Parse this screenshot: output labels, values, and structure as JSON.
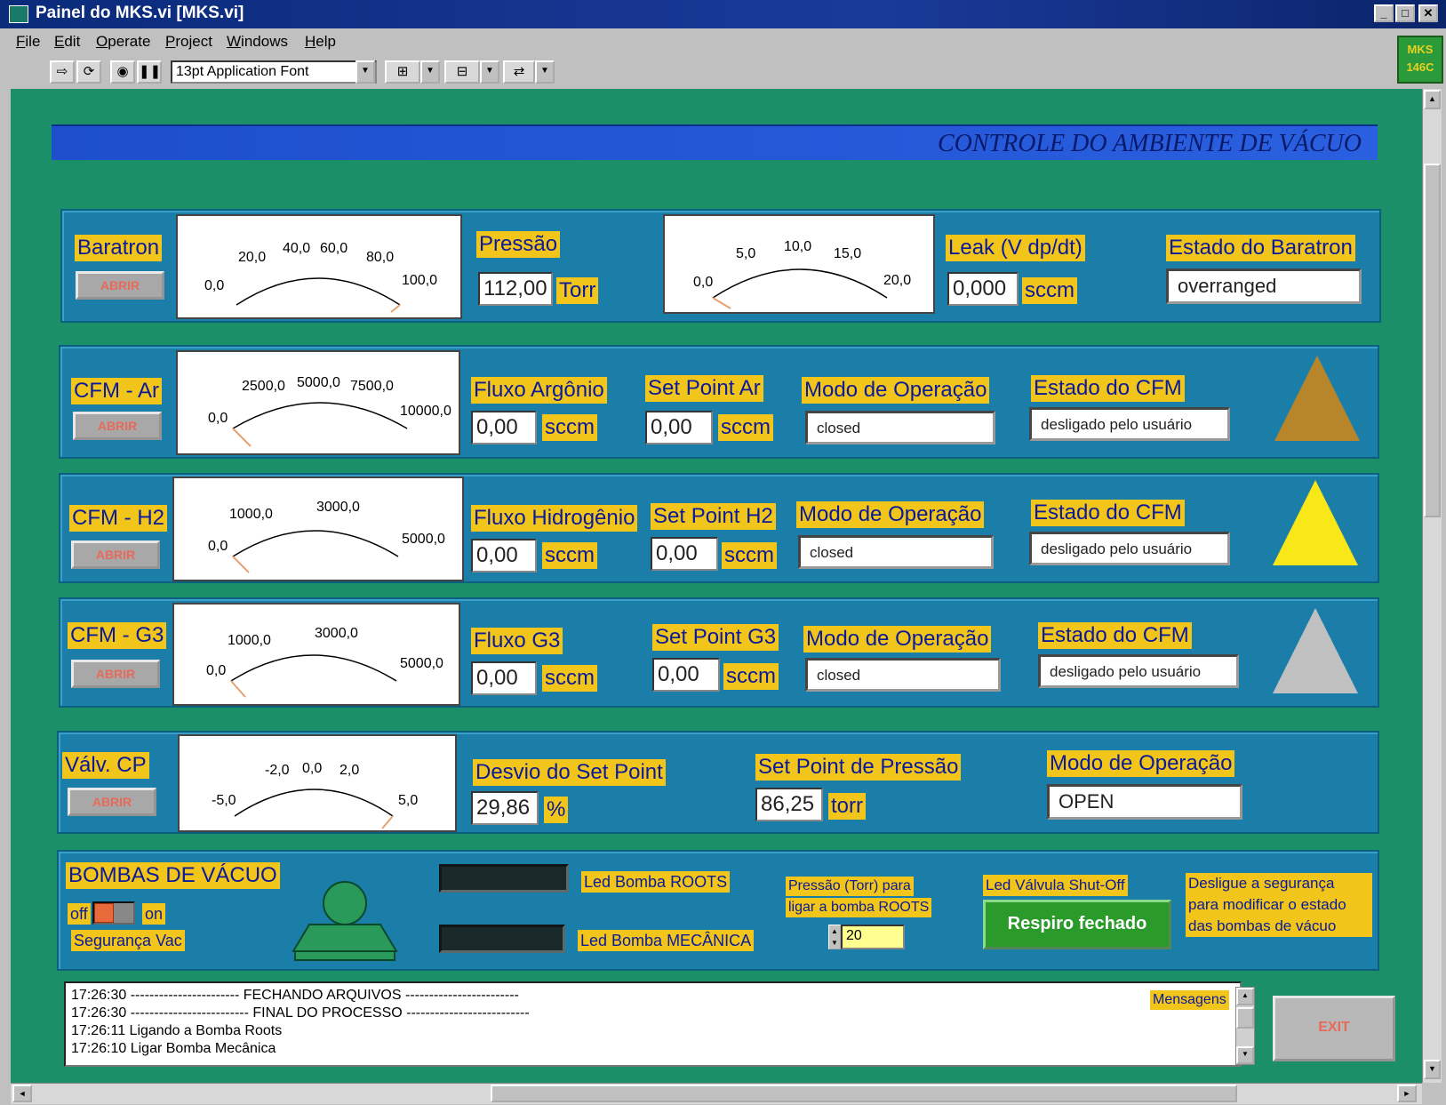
{
  "window": {
    "title": "Painel do MKS.vi [MKS.vi]",
    "buttons": [
      "_",
      "□",
      "✕"
    ]
  },
  "menu": [
    {
      "first": "F",
      "rest": "ile"
    },
    {
      "first": "E",
      "rest": "dit"
    },
    {
      "first": "O",
      "rest": "perate"
    },
    {
      "first": "P",
      "rest": "roject"
    },
    {
      "first": "W",
      "rest": "indows"
    },
    {
      "first": "H",
      "rest": "elp"
    }
  ],
  "toolbar": {
    "font": "13pt Application Font"
  },
  "badge": {
    "line1": "MKS",
    "line2": "146C"
  },
  "header": "CONTROLE DO AMBIENTE DE VÁCUO",
  "baratron": {
    "label": "Baratron",
    "button": "ABRIR",
    "gauge1": {
      "ticks": [
        "0,0",
        "20,0",
        "40,0",
        "60,0",
        "80,0",
        "100,0"
      ]
    },
    "pressao_label": "Pressão",
    "pressao_value": "112,00",
    "pressao_unit": "Torr",
    "gauge2": {
      "ticks": [
        "0,0",
        "5,0",
        "10,0",
        "15,0",
        "20,0"
      ]
    },
    "leak_label": "Leak (V dp/dt)",
    "leak_value": "0,000",
    "leak_unit": "sccm",
    "estado_label": "Estado do Baratron",
    "estado_value": "overranged"
  },
  "cfm_ar": {
    "label": "CFM - Ar",
    "button": "ABRIR",
    "ticks": [
      "0,0",
      "2500,0",
      "5000,0",
      "7500,0",
      "10000,0"
    ],
    "fluxo_label": "Fluxo Argônio",
    "fluxo_value": "0,00",
    "unit": "sccm",
    "sp_label": "Set Point Ar",
    "sp_value": "0,00",
    "modo_label": "Modo de Operação",
    "modo_value": "closed",
    "estado_label": "Estado do CFM",
    "estado_value": "desligado pelo usuário",
    "tri_color": "#b8862a"
  },
  "cfm_h2": {
    "label": "CFM - H2",
    "button": "ABRIR",
    "ticks": [
      "0,0",
      "1000,0",
      "3000,0",
      "5000,0"
    ],
    "fluxo_label": "Fluxo Hidrogênio",
    "fluxo_value": "0,00",
    "unit": "sccm",
    "sp_label": "Set Point H2",
    "sp_value": "0,00",
    "modo_label": "Modo de Operação",
    "modo_value": "closed",
    "estado_label": "Estado do CFM",
    "estado_value": "desligado pelo usuário",
    "tri_color": "#f8e81a"
  },
  "cfm_g3": {
    "label": "CFM - G3",
    "button": "ABRIR",
    "ticks": [
      "0,0",
      "1000,0",
      "3000,0",
      "5000,0"
    ],
    "fluxo_label": "Fluxo G3",
    "fluxo_value": "0,00",
    "unit": "sccm",
    "sp_label": "Set Point G3",
    "sp_value": "0,00",
    "modo_label": "Modo de Operação",
    "modo_value": "closed",
    "estado_label": "Estado do CFM",
    "estado_value": "desligado pelo usuário",
    "tri_color": "#c0c0c0"
  },
  "valv": {
    "label": "Válv. CP",
    "button": "ABRIR",
    "ticks": [
      "-5,0",
      "-2,0",
      "0,0",
      "2,0",
      "5,0"
    ],
    "desvio_label": "Desvio do Set Point",
    "desvio_value": "29,86",
    "desvio_unit": "%",
    "sp_label": "Set Point de Pressão",
    "sp_value": "86,25",
    "sp_unit": "torr",
    "modo_label": "Modo de Operação",
    "modo_value": "OPEN"
  },
  "bombas": {
    "label": "BOMBAS DE VÁCUO",
    "off": "off",
    "on": "on",
    "seguranca": "Segurança Vac",
    "led_roots": "Led Bomba ROOTS",
    "led_mecanica": "Led Bomba MECÂNICA",
    "pressao_label_1": "Pressão (Torr)  para",
    "pressao_label_2": "ligar a bomba  ROOTS",
    "pressao_value": "20",
    "led_valvula": "Led Válvula Shut-Off",
    "respiro": "Respiro fechado",
    "aviso_1": "Desligue a segurança",
    "aviso_2": "para modificar o estado",
    "aviso_3": "das bombas de vácuo"
  },
  "log": {
    "lines": [
      "17:26:30 ----------------------- FECHANDO ARQUIVOS ------------------------",
      "17:26:30 ------------------------- FINAL DO PROCESSO --------------------------",
      "17:26:11 Ligando a Bomba Roots",
      "17:26:10 Ligar Bomba Mecânica"
    ],
    "label": "Mensagens"
  },
  "exit": "EXIT"
}
